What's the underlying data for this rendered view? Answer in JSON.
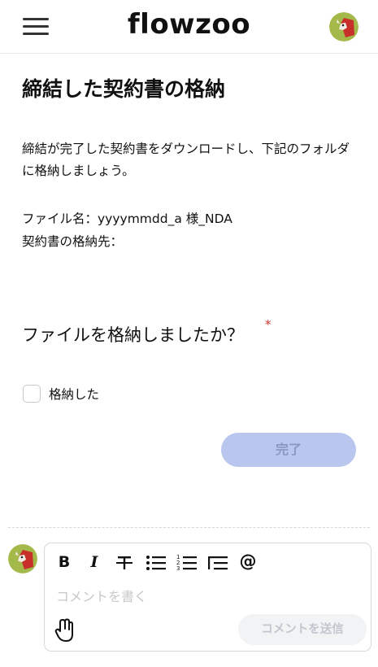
{
  "header": {
    "logo": "flowzoo",
    "menu_icon": "hamburger-menu-icon",
    "avatar_icon": "user-avatar-icon"
  },
  "task": {
    "title": "締結した契約書の格納",
    "description": "締結が完了した契約書をダウンロードし、下記のフォルダに格納しましょう。",
    "file_name": "ファイル名：yyyymmdd_a 様_NDA",
    "location": "契約書の格納先："
  },
  "question": {
    "label": "ファイルを格納しましたか？",
    "required_mark": "*",
    "checkbox_label": "格納した",
    "checked": false
  },
  "done_button": {
    "label": "完了"
  },
  "comment": {
    "toolbar": {
      "bold": "B",
      "italic": "I",
      "mention": "@"
    },
    "placeholder": "コメントを書く",
    "send_label": "コメントを送信",
    "attach_icon": "attachment-icon"
  },
  "colors": {
    "accent": "#b9c6ee",
    "required": "#d0302d",
    "avatar_green": "#a3b94a",
    "avatar_red": "#c62f2a"
  }
}
